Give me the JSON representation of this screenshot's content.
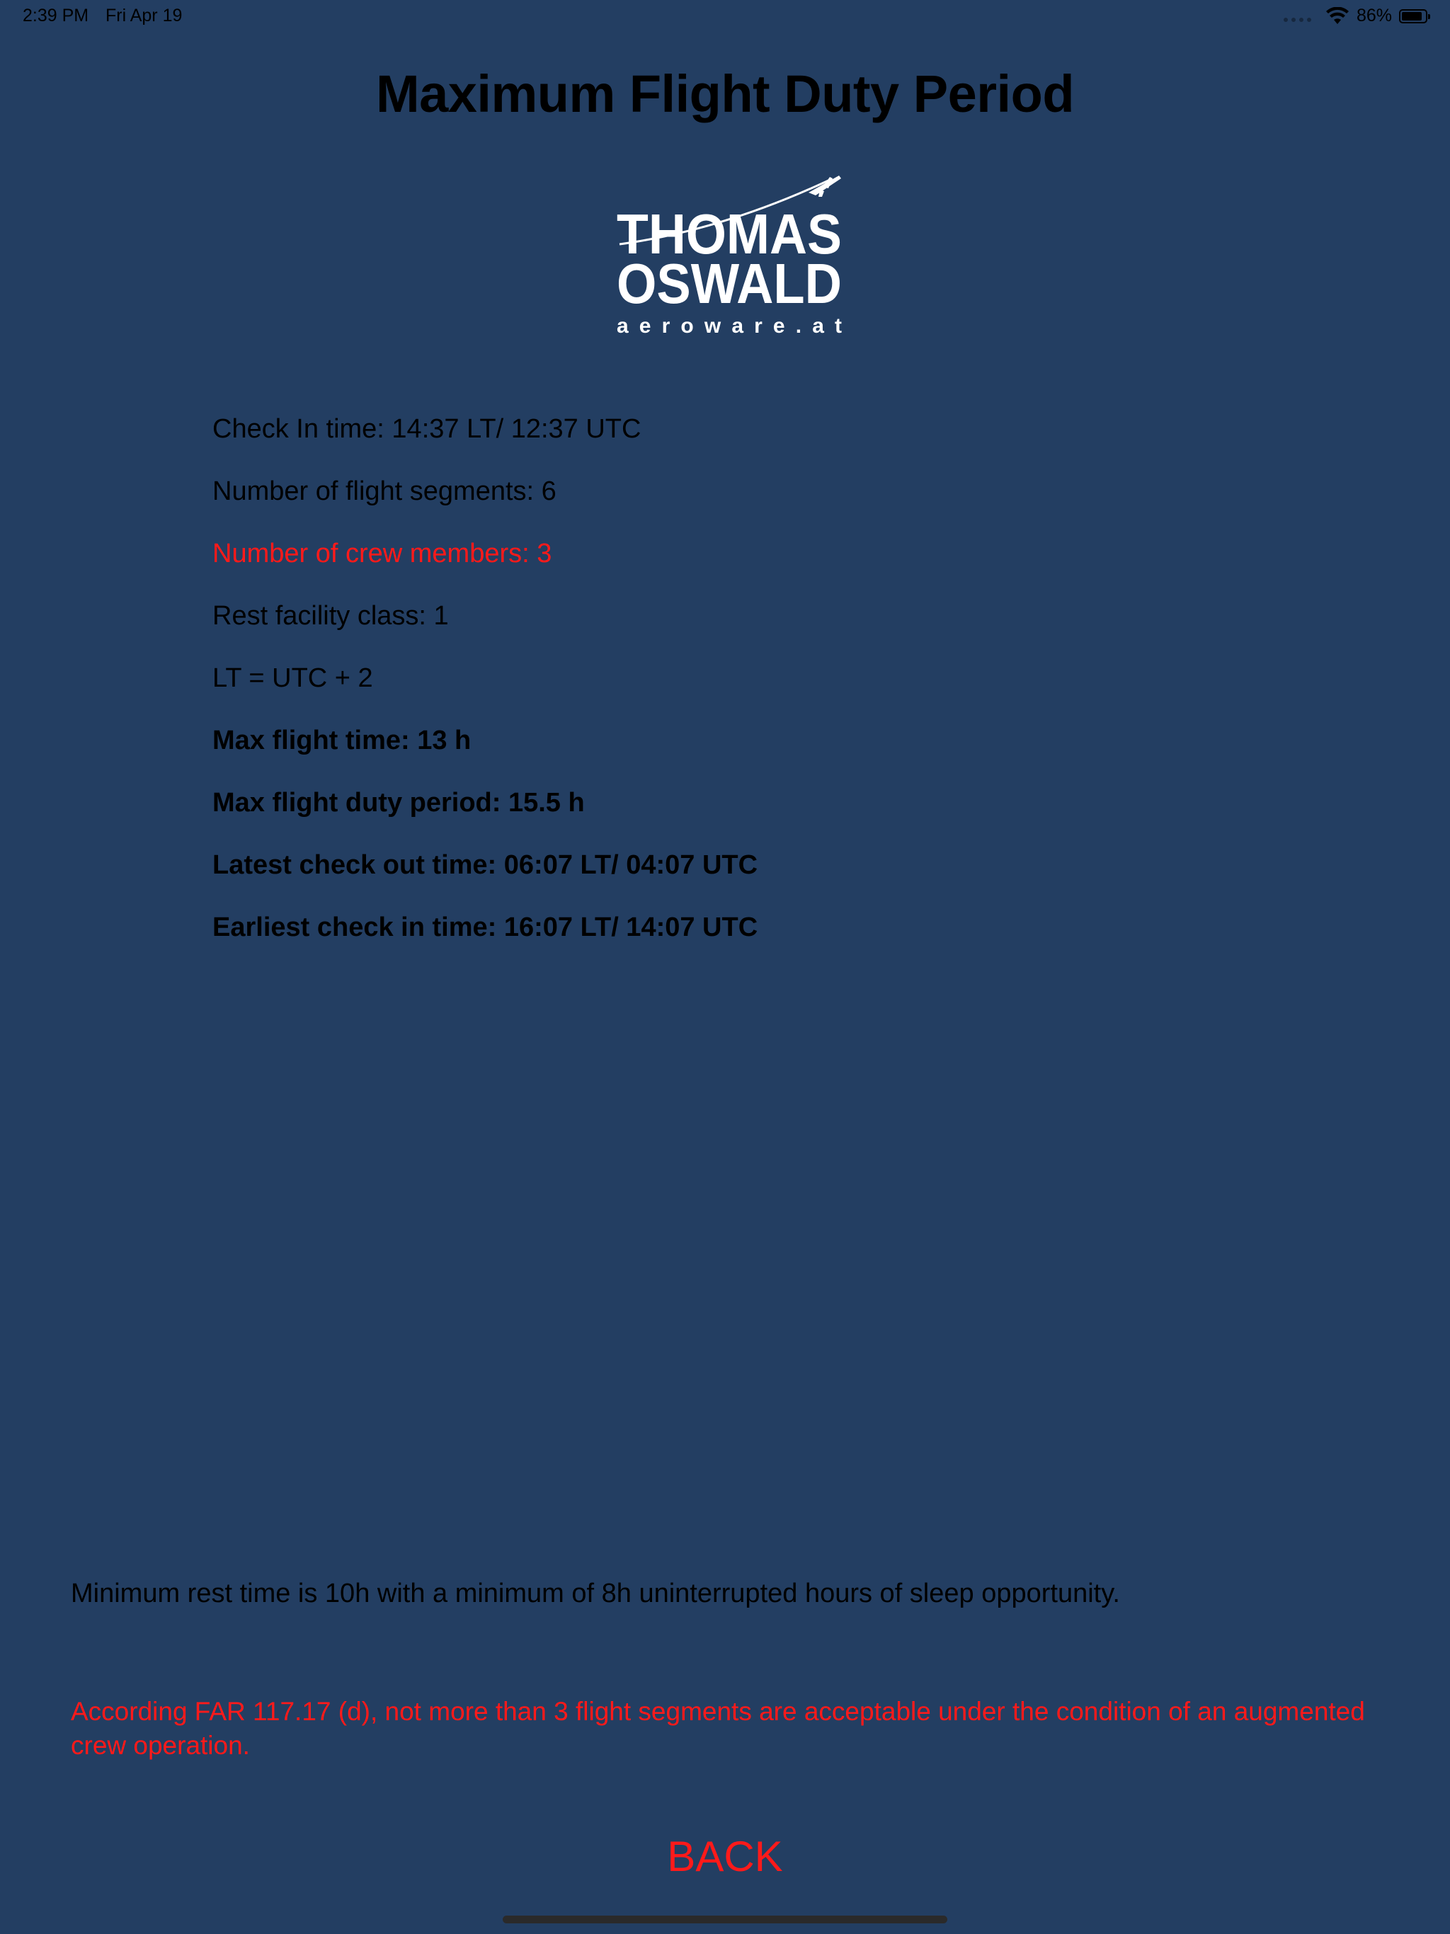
{
  "status_bar": {
    "time": "2:39 PM",
    "date": "Fri Apr 19",
    "battery_percent_label": "86%",
    "battery_level": 0.86,
    "icons": [
      "cellular-dots-icon",
      "wifi-icon",
      "battery-icon"
    ]
  },
  "page": {
    "title": "Maximum Flight Duty Period"
  },
  "logo": {
    "line1": "THOMAS",
    "line2": "OSWALD",
    "line3": "aeroware.at",
    "icon": "airplane-icon"
  },
  "info": {
    "check_in": "Check In time: 14:37 LT/ 12:37 UTC",
    "segments": "Number of flight segments: 6",
    "crew": "Number of crew members: 3",
    "rest_facility": "Rest facility class: 1",
    "lt_offset": "LT = UTC + 2",
    "max_flight_time": "Max flight time: 13 h",
    "max_fdp": "Max flight duty period: 15.5 h",
    "latest_check_out": "Latest check out time: 06:07 LT/ 04:07 UTC",
    "earliest_check_in": "Earliest check in time: 16:07 LT/ 14:07 UTC"
  },
  "notes": {
    "rest": "Minimum rest time is 10h with a minimum of 8h uninterrupted hours of sleep opportunity.",
    "warning": "According FAR 117.17 (d), not more than 3 flight segments are acceptable under the condition of an augmented crew operation."
  },
  "actions": {
    "back_label": "BACK"
  },
  "colors": {
    "background": "#233e62",
    "warning_red": "#ff1a1a",
    "text": "#000000",
    "logo_white": "#ffffff"
  }
}
